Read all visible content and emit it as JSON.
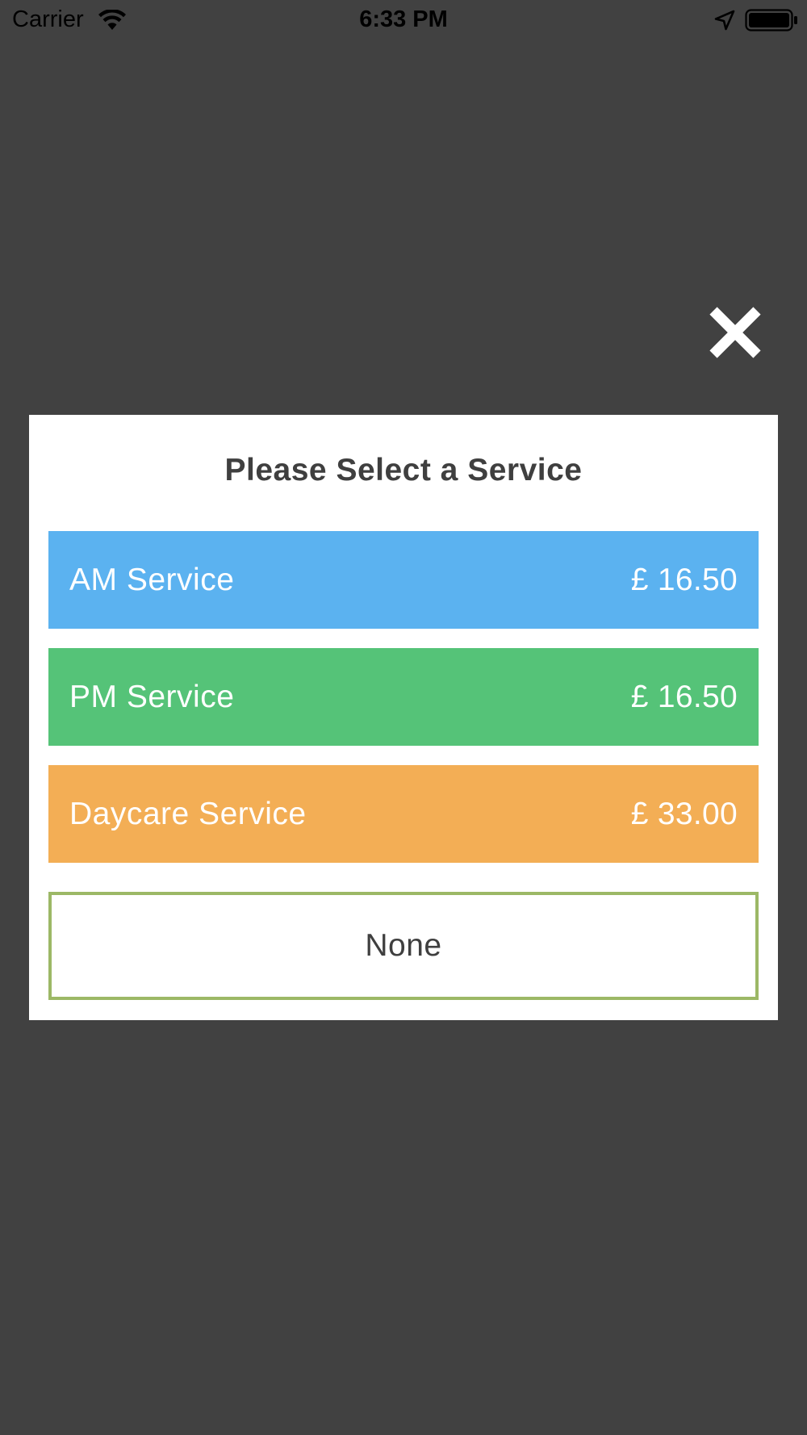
{
  "status_bar": {
    "carrier": "Carrier",
    "time": "6:33 PM",
    "icons": [
      "wifi-icon",
      "location-arrow-icon",
      "battery-icon"
    ]
  },
  "overlay": {
    "background_color": "#414141",
    "close_icon": "close-icon"
  },
  "modal": {
    "title": "Please Select a Service",
    "services": [
      {
        "label": "AM Service",
        "price": "£ 16.50",
        "color": "#5bb2f0"
      },
      {
        "label": "PM Service",
        "price": "£ 16.50",
        "color": "#55c378"
      },
      {
        "label": "Daycare Service",
        "price": "£ 33.00",
        "color": "#f3ae55"
      }
    ],
    "none_label": "None",
    "none_border_color": "#9cb866"
  }
}
